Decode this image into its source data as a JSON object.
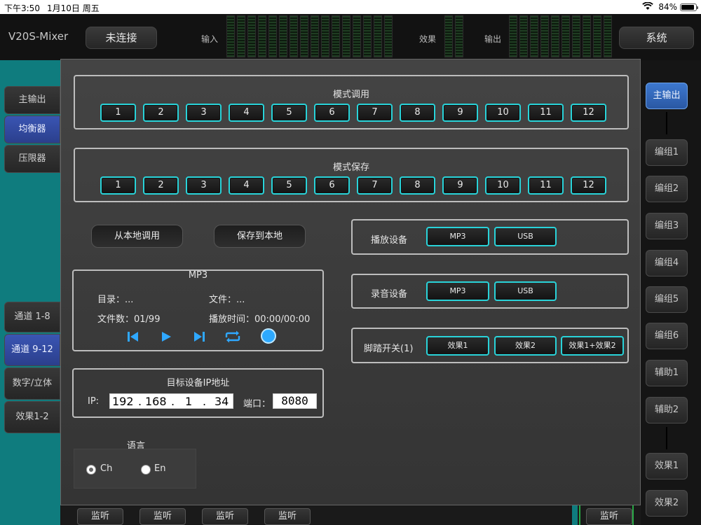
{
  "status": {
    "time": "下午3:50",
    "date": "1月10日 周五",
    "battery": "84%"
  },
  "topbar": {
    "app_title": "V20S-Mixer",
    "connection": "未连接",
    "label_input": "输入",
    "label_effects": "效果",
    "label_output": "输出",
    "system": "系统"
  },
  "left_tabs": [
    "主输出",
    "均衡器",
    "压限器",
    "通道 1-8",
    "通道 9-12",
    "数字/立体",
    "效果1-2"
  ],
  "right_buttons": [
    "主输出",
    "编组1",
    "编组2",
    "编组3",
    "编组4",
    "编组5",
    "编组6",
    "辅助1",
    "辅助2",
    "效果1",
    "效果2"
  ],
  "bottom": {
    "monitor": "监听"
  },
  "dialog": {
    "preset_recall": {
      "title": "模式调用",
      "numbers": [
        "1",
        "2",
        "3",
        "4",
        "5",
        "6",
        "7",
        "8",
        "9",
        "10",
        "11",
        "12"
      ]
    },
    "preset_save": {
      "title": "模式保存",
      "numbers": [
        "1",
        "2",
        "3",
        "4",
        "5",
        "6",
        "7",
        "8",
        "9",
        "10",
        "11",
        "12"
      ]
    },
    "load_local": "从本地调用",
    "save_local": "保存到本地",
    "mp3": {
      "title": "MP3",
      "dir_label": "目录：...",
      "file_label": "文件：...",
      "file_count": "文件数：01/99",
      "play_time": "播放时间：00:00/00:00"
    },
    "target": {
      "title": "目标设备IP地址",
      "ip_label": "IP:",
      "ip": [
        "192",
        "168",
        "1",
        "34"
      ],
      "port_label": "端口：",
      "port": "8080"
    },
    "language": {
      "title": "语言",
      "options": [
        "Ch",
        "En"
      ],
      "selected": "Ch"
    },
    "play_device": {
      "label": "播放设备",
      "options": [
        "MP3",
        "USB"
      ]
    },
    "record_device": {
      "label": "录音设备",
      "options": [
        "MP3",
        "USB"
      ]
    },
    "footswitch": {
      "label": "脚踏开关(1)",
      "options": [
        "效果1",
        "效果2",
        "效果1+效果2"
      ]
    }
  }
}
